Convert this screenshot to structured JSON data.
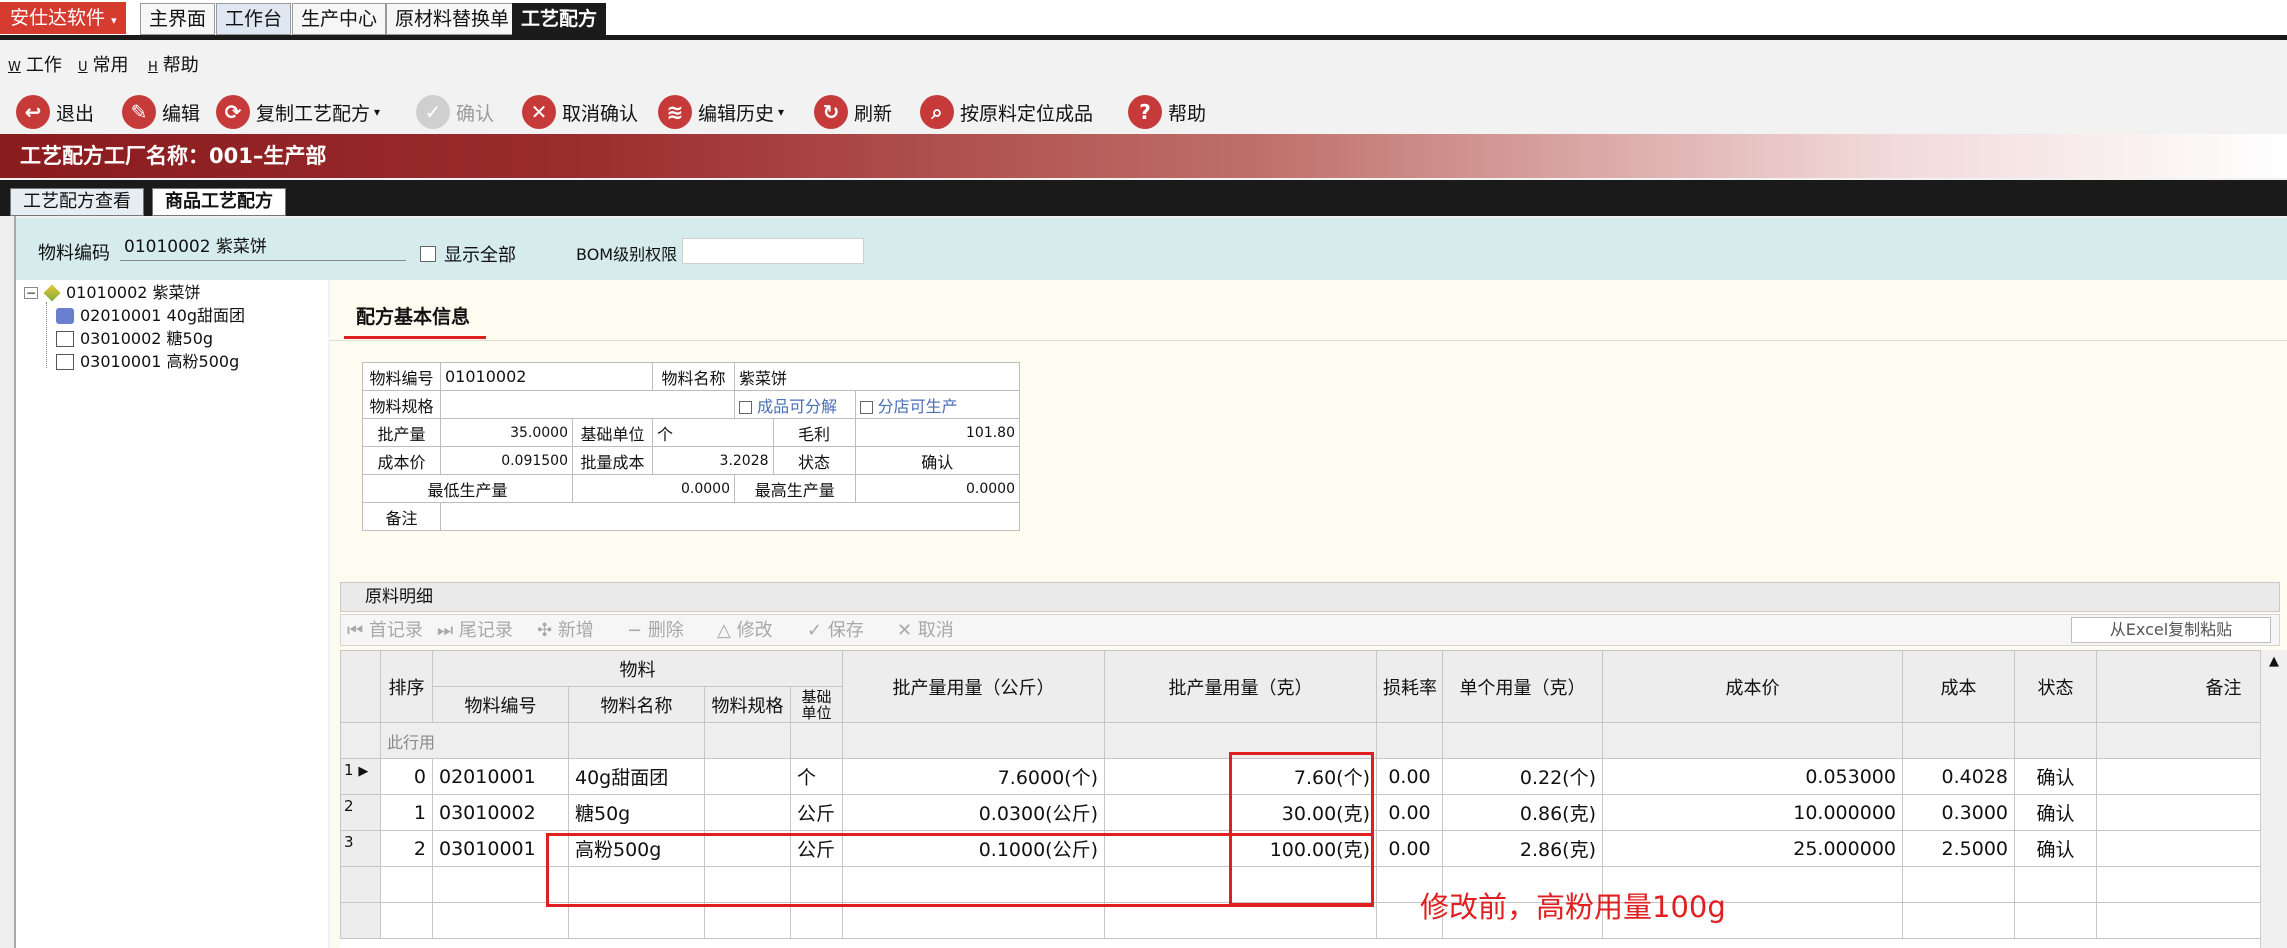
{
  "brand": "安仕达软件",
  "top_tabs": [
    "主界面",
    "工作台",
    "生产中心",
    "原材料替换单",
    "工艺配方"
  ],
  "menu": [
    {
      "key": "W",
      "label": "工作"
    },
    {
      "key": "U",
      "label": "常用"
    },
    {
      "key": "H",
      "label": "帮助"
    }
  ],
  "toolbar": {
    "exit": "退出",
    "edit": "编辑",
    "copy": "复制工艺配方",
    "confirm": "确认",
    "cancel_confirm": "取消确认",
    "edit_history": "编辑历史",
    "refresh": "刷新",
    "locate": "按原料定位成品",
    "help": "帮助"
  },
  "banner": "工艺配方工厂名称：001–生产部",
  "sub_tabs": [
    "工艺配方查看",
    "商品工艺配方"
  ],
  "filter": {
    "material_code_label": "物料编码",
    "material_code_value": "01010002 紫菜饼",
    "show_all": "显示全部",
    "bom_label": "BOM级别权限",
    "bom_value": ""
  },
  "tree": {
    "root": "01010002 紫菜饼",
    "children": [
      "02010001 40g甜面团",
      "03010002 糖50g",
      "03010001 高粉500g"
    ]
  },
  "info": {
    "title": "配方基本信息",
    "item_code_label": "物料编号",
    "item_code": "01010002",
    "item_name_label": "物料名称",
    "item_name": "紫菜饼",
    "spec_label": "物料规格",
    "spec": "",
    "decomposable": "成品可分解",
    "branch_produce": "分店可生产",
    "batch_qty_label": "批产量",
    "batch_qty": "35.0000",
    "base_unit_label": "基础单位",
    "base_unit": "个",
    "gross_label": "毛利",
    "gross": "101.80",
    "cost_price_label": "成本价",
    "cost_price": "0.091500",
    "batch_cost_label": "批量成本",
    "batch_cost": "3.2028",
    "status_label": "状态",
    "status": "确认",
    "min_label": "最低生产量",
    "min": "0.0000",
    "max_label": "最高生产量",
    "max": "0.0000",
    "remark_label": "备注",
    "remark": ""
  },
  "grid_caption": "原料明细",
  "grid_tools": {
    "first": "首记录",
    "last": "尾记录",
    "add": "新增",
    "delete": "删除",
    "modify": "修改",
    "save": "保存",
    "cancel": "取消",
    "excel": "从Excel复制粘贴"
  },
  "headers": {
    "seq": "排序",
    "material": "物料",
    "code": "物料编号",
    "name": "物料名称",
    "spec": "物料规格",
    "unit": "基础单位",
    "qty_kg": "批产量用量（公斤）",
    "qty_g": "批产量用量（克）",
    "loss": "损耗率",
    "unit_use": "单个用量（克）",
    "cost_price": "成本价",
    "cost": "成本",
    "status": "状态",
    "remark": "备注"
  },
  "hint_row": "此行用",
  "rows": [
    {
      "rownum": "1",
      "seq": "0",
      "code": "02010001",
      "name": "40g甜面团",
      "spec": "",
      "unit": "个",
      "qty_kg": "7.6000(个)",
      "qty_g": "7.60(个)",
      "loss": "0.00",
      "unit_use": "0.22(个)",
      "cost_price": "0.053000",
      "cost": "0.4028",
      "status": "确认",
      "remark": ""
    },
    {
      "rownum": "2",
      "seq": "1",
      "code": "03010002",
      "name": "糖50g",
      "spec": "",
      "unit": "公斤",
      "qty_kg": "0.0300(公斤)",
      "qty_g": "30.00(克)",
      "loss": "0.00",
      "unit_use": "0.86(克)",
      "cost_price": "10.000000",
      "cost": "0.3000",
      "status": "确认",
      "remark": ""
    },
    {
      "rownum": "3",
      "seq": "2",
      "code": "03010001",
      "name": "高粉500g",
      "spec": "",
      "unit": "公斤",
      "qty_kg": "0.1000(公斤)",
      "qty_g": "100.00(克)",
      "loss": "0.00",
      "unit_use": "2.86(克)",
      "cost_price": "25.000000",
      "cost": "2.5000",
      "status": "确认",
      "remark": ""
    }
  ],
  "annotation": "修改前，高粉用量100g",
  "colors": {
    "accent_red": "#d63b2f",
    "annotation_red": "#e02020",
    "banner_dark": "#8a1b1e"
  }
}
